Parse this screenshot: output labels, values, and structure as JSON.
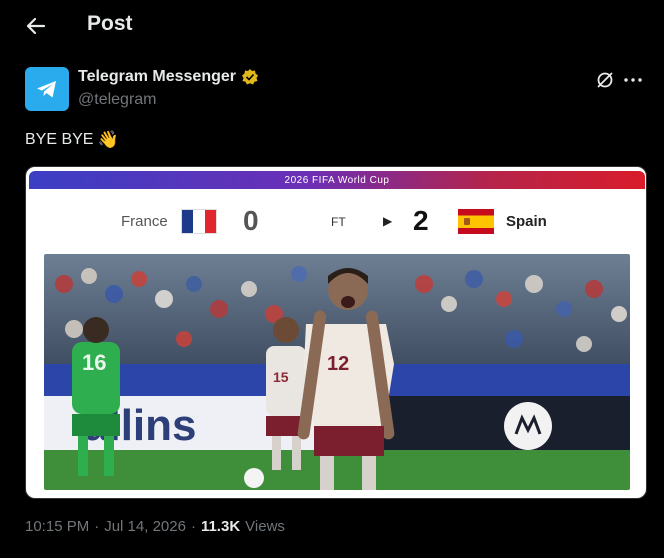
{
  "header": {
    "title": "Post",
    "back_icon": "arrow-left-icon"
  },
  "author": {
    "name": "Telegram Messenger",
    "handle": "@telegram",
    "verified_badge": "gold-verified-badge",
    "avatar_icon": "telegram-logo-icon",
    "avatar_color": "#2aabee"
  },
  "post": {
    "text": "BYE BYE",
    "emoji": "👋"
  },
  "media": {
    "banner": "2026 FIFA World Cup",
    "home_team": "France",
    "home_score": "0",
    "status": "FT",
    "away_score": "2",
    "away_team": "Spain",
    "banner_colors": [
      "#3a3fc4",
      "#d91c2a"
    ],
    "ad_board_text": "allins",
    "player_number_left": "15",
    "player_number_main": "12",
    "goalkeeper_number": "16"
  },
  "footer": {
    "time": "10:15 PM",
    "separator": "·",
    "date": "Jul 14, 2026",
    "views_count": "11.3K",
    "views_label": "Views"
  }
}
